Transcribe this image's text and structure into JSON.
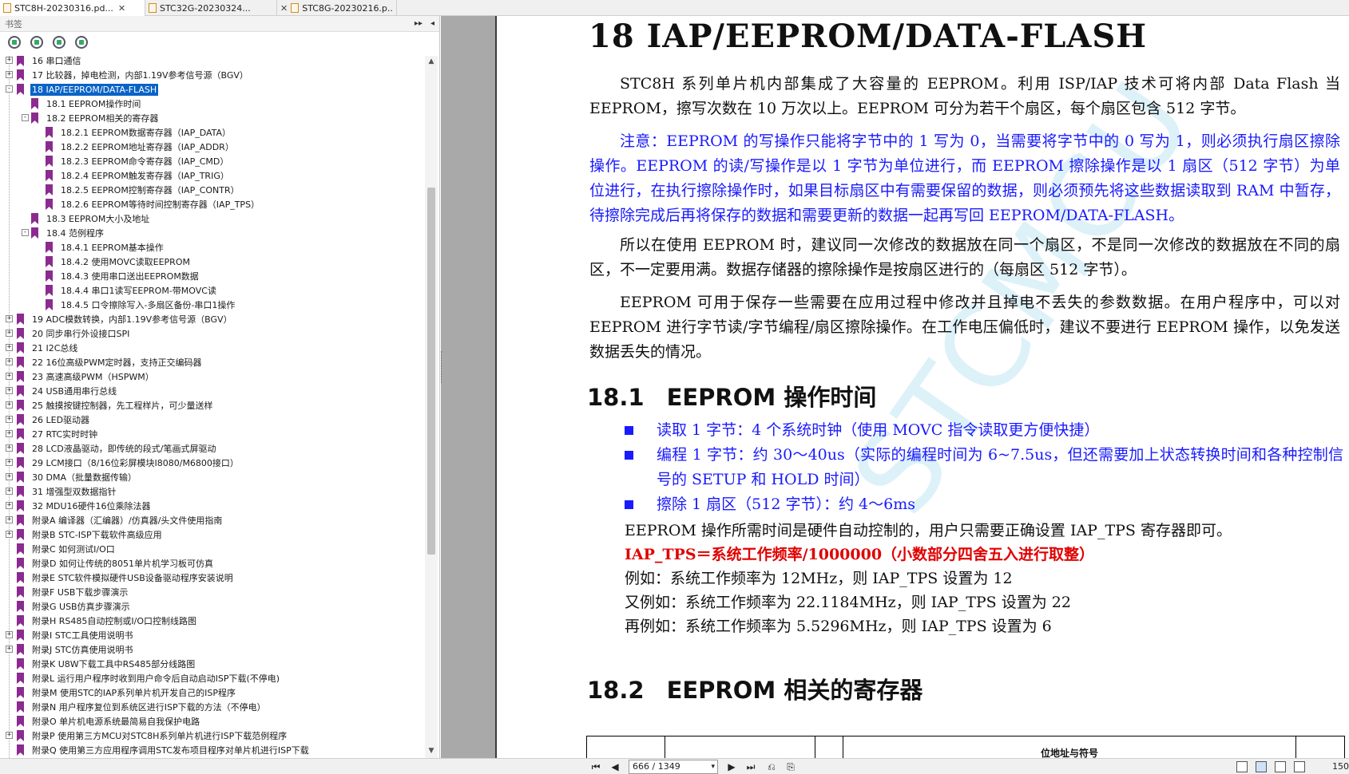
{
  "tabs": [
    {
      "label": "STC8H-20230316.pd...",
      "active": true
    },
    {
      "label": "STC32G-20230324...",
      "active": false
    },
    {
      "label": "STC8G-20230216.p...",
      "active": false
    }
  ],
  "panel": {
    "title": "书签"
  },
  "bookmarks": [
    {
      "label": "16 串口通信",
      "level": 0,
      "expander": "+"
    },
    {
      "label": "17 比较器，掉电检测，内部1.19V参考信号源（BGV）",
      "level": 0,
      "expander": "+"
    },
    {
      "label": "18 IAP/EEPROM/DATA-FLASH",
      "level": 0,
      "expander": "-",
      "selected": true
    },
    {
      "label": "18.1 EEPROM操作时间",
      "level": 1,
      "expander": ""
    },
    {
      "label": "18.2 EEPROM相关的寄存器",
      "level": 1,
      "expander": "-"
    },
    {
      "label": "18.2.1 EEPROM数据寄存器（IAP_DATA）",
      "level": 2,
      "expander": ""
    },
    {
      "label": "18.2.2 EEPROM地址寄存器（IAP_ADDR）",
      "level": 2,
      "expander": ""
    },
    {
      "label": "18.2.3 EEPROM命令寄存器（IAP_CMD）",
      "level": 2,
      "expander": ""
    },
    {
      "label": "18.2.4 EEPROM触发寄存器（IAP_TRIG）",
      "level": 2,
      "expander": ""
    },
    {
      "label": "18.2.5 EEPROM控制寄存器（IAP_CONTR）",
      "level": 2,
      "expander": ""
    },
    {
      "label": "18.2.6 EEPROM等待时间控制寄存器（IAP_TPS）",
      "level": 2,
      "expander": ""
    },
    {
      "label": "18.3 EEPROM大小及地址",
      "level": 1,
      "expander": ""
    },
    {
      "label": "18.4 范例程序",
      "level": 1,
      "expander": "-"
    },
    {
      "label": "18.4.1 EEPROM基本操作",
      "level": 2,
      "expander": ""
    },
    {
      "label": "18.4.2 使用MOVC读取EEPROM",
      "level": 2,
      "expander": ""
    },
    {
      "label": "18.4.3 使用串口送出EEPROM数据",
      "level": 2,
      "expander": ""
    },
    {
      "label": "18.4.4 串口1读写EEPROM-带MOVC读",
      "level": 2,
      "expander": ""
    },
    {
      "label": "18.4.5 口令擦除写入-多扇区备份-串口1操作",
      "level": 2,
      "expander": ""
    },
    {
      "label": "19 ADC模数转换，内部1.19V参考信号源（BGV）",
      "level": 0,
      "expander": "+"
    },
    {
      "label": "20 同步串行外设接口SPI",
      "level": 0,
      "expander": "+"
    },
    {
      "label": "21 I2C总线",
      "level": 0,
      "expander": "+"
    },
    {
      "label": "22 16位高级PWM定时器，支持正交编码器",
      "level": 0,
      "expander": "+"
    },
    {
      "label": "23 高速高级PWM（HSPWM）",
      "level": 0,
      "expander": "+"
    },
    {
      "label": "24 USB通用串行总线",
      "level": 0,
      "expander": "+"
    },
    {
      "label": "25 触摸按键控制器，先工程样片，可少量送样",
      "level": 0,
      "expander": "+"
    },
    {
      "label": "26 LED驱动器",
      "level": 0,
      "expander": "+"
    },
    {
      "label": "27 RTC实时时钟",
      "level": 0,
      "expander": "+"
    },
    {
      "label": "28 LCD液晶驱动，即传统的段式/笔画式屏驱动",
      "level": 0,
      "expander": "+"
    },
    {
      "label": "29 LCM接口（8/16位彩屏模块I8080/M6800接口）",
      "level": 0,
      "expander": "+"
    },
    {
      "label": "30 DMA（批量数据传输）",
      "level": 0,
      "expander": "+"
    },
    {
      "label": "31 增强型双数据指针",
      "level": 0,
      "expander": "+"
    },
    {
      "label": "32 MDU16硬件16位乘除法器",
      "level": 0,
      "expander": "+"
    },
    {
      "label": "附录A 编译器（汇编器）/仿真器/头文件使用指南",
      "level": 0,
      "expander": "+"
    },
    {
      "label": "附录B STC-ISP下载软件高级应用",
      "level": 0,
      "expander": "+"
    },
    {
      "label": "附录C 如何测试I/O口",
      "level": 0,
      "expander": ""
    },
    {
      "label": "附录D 如何让传统的8051单片机学习板可仿真",
      "level": 0,
      "expander": ""
    },
    {
      "label": "附录E STC软件模拟硬件USB设备驱动程序安装说明",
      "level": 0,
      "expander": ""
    },
    {
      "label": "附录F USB下载步骤演示",
      "level": 0,
      "expander": ""
    },
    {
      "label": "附录G USB仿真步骤演示",
      "level": 0,
      "expander": ""
    },
    {
      "label": "附录H RS485自动控制或I/O口控制线路图",
      "level": 0,
      "expander": ""
    },
    {
      "label": "附录I STC工具使用说明书",
      "level": 0,
      "expander": "+"
    },
    {
      "label": "附录J STC仿真使用说明书",
      "level": 0,
      "expander": "+"
    },
    {
      "label": "附录K U8W下载工具中RS485部分线路图",
      "level": 0,
      "expander": ""
    },
    {
      "label": "附录L 运行用户程序时收到用户命令后自动启动ISP下载(不停电)",
      "level": 0,
      "expander": ""
    },
    {
      "label": "附录M 使用STC的IAP系列单片机开发自己的ISP程序",
      "level": 0,
      "expander": ""
    },
    {
      "label": "附录N 用户程序复位到系统区进行ISP下载的方法（不停电）",
      "level": 0,
      "expander": ""
    },
    {
      "label": "附录O 单片机电源系统最简易自我保护电路",
      "level": 0,
      "expander": ""
    },
    {
      "label": "附录P 使用第三方MCU对STC8H系列单片机进行ISP下载范例程序",
      "level": 0,
      "expander": "+"
    },
    {
      "label": "附录Q 使用第三方应用程序调用STC发布项目程序对单片机进行ISP下载",
      "level": 0,
      "expander": ""
    }
  ],
  "document": {
    "title": "18 IAP/EEPROM/DATA-FLASH",
    "p1": "STC8H 系列单片机内部集成了大容量的 EEPROM。利用 ISP/IAP 技术可将内部 Data Flash 当 EEPROM，擦写次数在 10 万次以上。EEPROM 可分为若干个扇区，每个扇区包含 512 字节。",
    "note": "注意：EEPROM 的写操作只能将字节中的 1 写为 0，当需要将字节中的 0 写为 1，则必须执行扇区擦除操作。EEPROM 的读/写操作是以 1 字节为单位进行，而 EEPROM 擦除操作是以 1 扇区（512 字节）为单位进行，在执行擦除操作时，如果目标扇区中有需要保留的数据，则必须预先将这些数据读取到 RAM 中暂存，待擦除完成后再将保存的数据和需要更新的数据一起再写回 EEPROM/DATA-FLASH。",
    "p2": "所以在使用 EEPROM 时，建议同一次修改的数据放在同一个扇区，不是同一次修改的数据放在不同的扇区，不一定要用满。数据存储器的擦除操作是按扇区进行的（每扇区 512 字节）。",
    "p3": "EEPROM 可用于保存一些需要在应用过程中修改并且掉电不丢失的参数数据。在用户程序中，可以对 EEPROM 进行字节读/字节编程/扇区擦除操作。在工作电压偏低时，建议不要进行 EEPROM 操作，以免发送数据丢失的情况。",
    "s1_num": "18.1",
    "s1_title": "EEPROM 操作时间",
    "bullets": [
      "读取 1 字节：4 个系统时钟（使用 MOVC 指令读取更方便快捷）",
      "编程 1 字节：约 30～40us（实际的编程时间为 6~7.5us，但还需要加上状态转换时间和各种控制信号的 SETUP 和 HOLD 时间）",
      "擦除 1 扇区（512 字节）：约 4～6ms"
    ],
    "line1": "EEPROM 操作所需时间是硬件自动控制的，用户只需要正确设置 IAP_TPS 寄存器即可。",
    "formula": "IAP_TPS＝系统工作频率/1000000（小数部分四舍五入进行取整）",
    "ex1": "例如：系统工作频率为 12MHz，则 IAP_TPS 设置为 12",
    "ex2": "又例如：系统工作频率为 22.1184MHz，则 IAP_TPS 设置为 22",
    "ex3": "再例如：系统工作频率为 5.5296MHz，则 IAP_TPS 设置为 6",
    "s2_num": "18.2",
    "s2_title": "EEPROM 相关的寄存器",
    "table_header": "位地址与符号",
    "watermark": "STCMCU"
  },
  "statusbar": {
    "page_value": "666 / 1349",
    "zoom": "150"
  }
}
